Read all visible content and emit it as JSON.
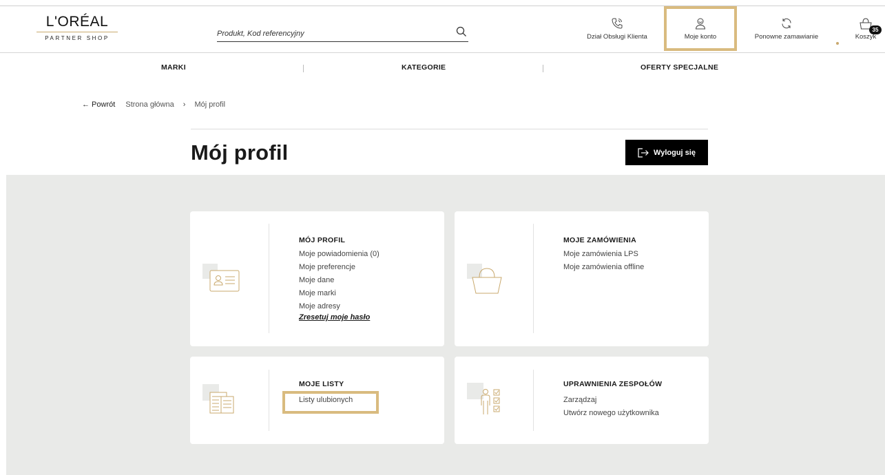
{
  "logo": {
    "main": "L'ORÉAL",
    "sub": "PARTNER SHOP"
  },
  "search": {
    "placeholder": "Produkt, Kod referencyjny"
  },
  "header_items": {
    "customer_service": "Dział Obsługi Klienta",
    "my_account": "Moje konto",
    "reorder": "Ponowne zamawianie",
    "cart": "Koszyk",
    "cart_count": "35"
  },
  "nav": {
    "brands": "MARKI",
    "categories": "KATEGORIE",
    "offers": "OFERTY SPECJALNE"
  },
  "breadcrumb": {
    "back": "← Powrót",
    "home": "Strona główna",
    "sep": "›",
    "current": "Mój profil"
  },
  "page": {
    "title": "Mój profil",
    "logout": "Wyloguj się"
  },
  "cards": {
    "profile": {
      "title": "MÓJ PROFIL",
      "links": [
        "Moje powiadomienia (0)",
        "Moje preferencje",
        "Moje dane",
        "Moje marki",
        "Moje adresy"
      ],
      "reset": "Zresetuj moje hasło"
    },
    "orders": {
      "title": "MOJE ZAMÓWIENIA",
      "links": [
        "Moje zamówienia LPS",
        "Moje zamówienia offline"
      ]
    },
    "lists": {
      "title": "MOJE LISTY",
      "links": [
        "Listy ulubionych"
      ]
    },
    "teams": {
      "title": "UPRAWNIENIA ZESPOŁÓW",
      "links": [
        "Zarządzaj",
        "Utwórz nowego użytkownika"
      ]
    }
  },
  "colors": {
    "accent_gold": "#c9a96e",
    "highlight": "#d9bb7f",
    "grey_bg": "#e9eae8",
    "black": "#000000"
  }
}
